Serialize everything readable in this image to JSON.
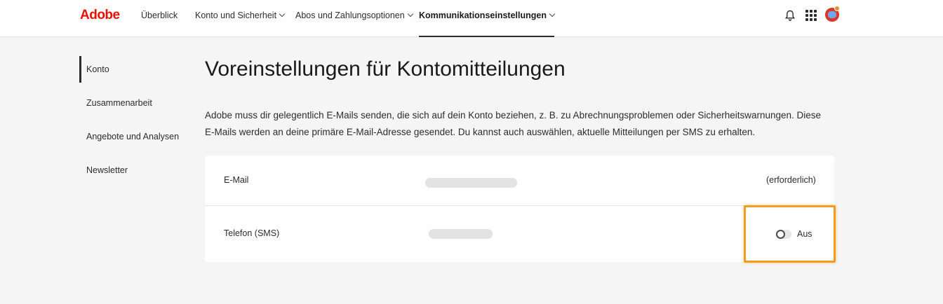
{
  "brand": {
    "logo_text": "Adobe",
    "logo_color": "#eb1000"
  },
  "nav": {
    "items": [
      {
        "label": "Überblick",
        "has_dropdown": false,
        "active": false
      },
      {
        "label": "Konto und Sicherheit",
        "has_dropdown": true,
        "active": false
      },
      {
        "label": "Abos und Zahlungsoptionen",
        "has_dropdown": true,
        "active": false
      },
      {
        "label": "Kommunikationseinstellungen",
        "has_dropdown": true,
        "active": true
      }
    ],
    "icons": [
      "bell-icon",
      "apps-grid-icon",
      "avatar"
    ]
  },
  "sidebar": {
    "items": [
      {
        "label": "Konto",
        "active": true
      },
      {
        "label": "Zusammenarbeit",
        "active": false
      },
      {
        "label": "Angebote und Analysen",
        "active": false
      },
      {
        "label": "Newsletter",
        "active": false
      }
    ]
  },
  "main": {
    "title": "Voreinstellungen für Kontomitteilungen",
    "description": "Adobe muss dir gelegentlich E-Mails senden, die sich auf dein Konto beziehen, z. B. zu Abrechnungsproblemen oder Sicherheitswarnungen. Diese E-Mails werden an deine primäre E-Mail-Adresse gesendet. Du kannst auch auswählen, aktuelle Mitteilungen per SMS zu erhalten.",
    "rows": [
      {
        "label": "E-Mail",
        "status": "(erforderlich)"
      },
      {
        "label": "Telefon (SMS)",
        "toggle_label": "Aus",
        "toggle_on": false
      }
    ]
  },
  "colors": {
    "highlight": "#f39c1f",
    "background": "#f5f5f5"
  }
}
